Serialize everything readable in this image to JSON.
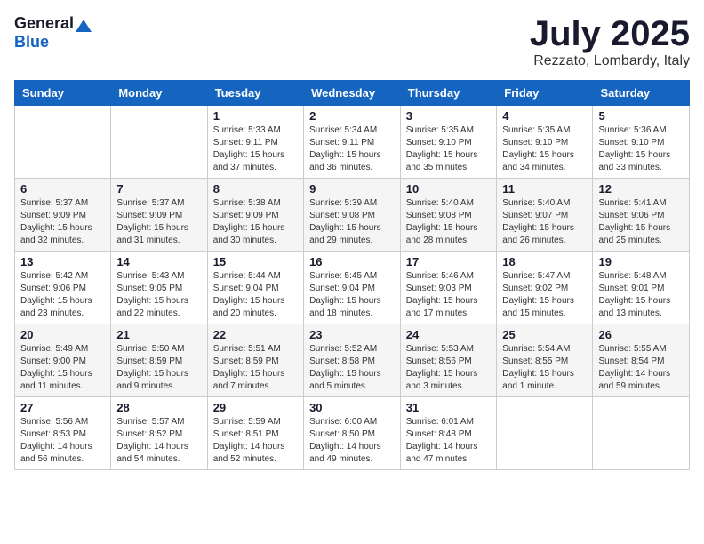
{
  "header": {
    "logo_general": "General",
    "logo_blue": "Blue",
    "month": "July 2025",
    "location": "Rezzato, Lombardy, Italy"
  },
  "days_of_week": [
    "Sunday",
    "Monday",
    "Tuesday",
    "Wednesday",
    "Thursday",
    "Friday",
    "Saturday"
  ],
  "weeks": [
    [
      {
        "day": "",
        "detail": ""
      },
      {
        "day": "",
        "detail": ""
      },
      {
        "day": "1",
        "detail": "Sunrise: 5:33 AM\nSunset: 9:11 PM\nDaylight: 15 hours\nand 37 minutes."
      },
      {
        "day": "2",
        "detail": "Sunrise: 5:34 AM\nSunset: 9:11 PM\nDaylight: 15 hours\nand 36 minutes."
      },
      {
        "day": "3",
        "detail": "Sunrise: 5:35 AM\nSunset: 9:10 PM\nDaylight: 15 hours\nand 35 minutes."
      },
      {
        "day": "4",
        "detail": "Sunrise: 5:35 AM\nSunset: 9:10 PM\nDaylight: 15 hours\nand 34 minutes."
      },
      {
        "day": "5",
        "detail": "Sunrise: 5:36 AM\nSunset: 9:10 PM\nDaylight: 15 hours\nand 33 minutes."
      }
    ],
    [
      {
        "day": "6",
        "detail": "Sunrise: 5:37 AM\nSunset: 9:09 PM\nDaylight: 15 hours\nand 32 minutes."
      },
      {
        "day": "7",
        "detail": "Sunrise: 5:37 AM\nSunset: 9:09 PM\nDaylight: 15 hours\nand 31 minutes."
      },
      {
        "day": "8",
        "detail": "Sunrise: 5:38 AM\nSunset: 9:09 PM\nDaylight: 15 hours\nand 30 minutes."
      },
      {
        "day": "9",
        "detail": "Sunrise: 5:39 AM\nSunset: 9:08 PM\nDaylight: 15 hours\nand 29 minutes."
      },
      {
        "day": "10",
        "detail": "Sunrise: 5:40 AM\nSunset: 9:08 PM\nDaylight: 15 hours\nand 28 minutes."
      },
      {
        "day": "11",
        "detail": "Sunrise: 5:40 AM\nSunset: 9:07 PM\nDaylight: 15 hours\nand 26 minutes."
      },
      {
        "day": "12",
        "detail": "Sunrise: 5:41 AM\nSunset: 9:06 PM\nDaylight: 15 hours\nand 25 minutes."
      }
    ],
    [
      {
        "day": "13",
        "detail": "Sunrise: 5:42 AM\nSunset: 9:06 PM\nDaylight: 15 hours\nand 23 minutes."
      },
      {
        "day": "14",
        "detail": "Sunrise: 5:43 AM\nSunset: 9:05 PM\nDaylight: 15 hours\nand 22 minutes."
      },
      {
        "day": "15",
        "detail": "Sunrise: 5:44 AM\nSunset: 9:04 PM\nDaylight: 15 hours\nand 20 minutes."
      },
      {
        "day": "16",
        "detail": "Sunrise: 5:45 AM\nSunset: 9:04 PM\nDaylight: 15 hours\nand 18 minutes."
      },
      {
        "day": "17",
        "detail": "Sunrise: 5:46 AM\nSunset: 9:03 PM\nDaylight: 15 hours\nand 17 minutes."
      },
      {
        "day": "18",
        "detail": "Sunrise: 5:47 AM\nSunset: 9:02 PM\nDaylight: 15 hours\nand 15 minutes."
      },
      {
        "day": "19",
        "detail": "Sunrise: 5:48 AM\nSunset: 9:01 PM\nDaylight: 15 hours\nand 13 minutes."
      }
    ],
    [
      {
        "day": "20",
        "detail": "Sunrise: 5:49 AM\nSunset: 9:00 PM\nDaylight: 15 hours\nand 11 minutes."
      },
      {
        "day": "21",
        "detail": "Sunrise: 5:50 AM\nSunset: 8:59 PM\nDaylight: 15 hours\nand 9 minutes."
      },
      {
        "day": "22",
        "detail": "Sunrise: 5:51 AM\nSunset: 8:59 PM\nDaylight: 15 hours\nand 7 minutes."
      },
      {
        "day": "23",
        "detail": "Sunrise: 5:52 AM\nSunset: 8:58 PM\nDaylight: 15 hours\nand 5 minutes."
      },
      {
        "day": "24",
        "detail": "Sunrise: 5:53 AM\nSunset: 8:56 PM\nDaylight: 15 hours\nand 3 minutes."
      },
      {
        "day": "25",
        "detail": "Sunrise: 5:54 AM\nSunset: 8:55 PM\nDaylight: 15 hours\nand 1 minute."
      },
      {
        "day": "26",
        "detail": "Sunrise: 5:55 AM\nSunset: 8:54 PM\nDaylight: 14 hours\nand 59 minutes."
      }
    ],
    [
      {
        "day": "27",
        "detail": "Sunrise: 5:56 AM\nSunset: 8:53 PM\nDaylight: 14 hours\nand 56 minutes."
      },
      {
        "day": "28",
        "detail": "Sunrise: 5:57 AM\nSunset: 8:52 PM\nDaylight: 14 hours\nand 54 minutes."
      },
      {
        "day": "29",
        "detail": "Sunrise: 5:59 AM\nSunset: 8:51 PM\nDaylight: 14 hours\nand 52 minutes."
      },
      {
        "day": "30",
        "detail": "Sunrise: 6:00 AM\nSunset: 8:50 PM\nDaylight: 14 hours\nand 49 minutes."
      },
      {
        "day": "31",
        "detail": "Sunrise: 6:01 AM\nSunset: 8:48 PM\nDaylight: 14 hours\nand 47 minutes."
      },
      {
        "day": "",
        "detail": ""
      },
      {
        "day": "",
        "detail": ""
      }
    ]
  ]
}
